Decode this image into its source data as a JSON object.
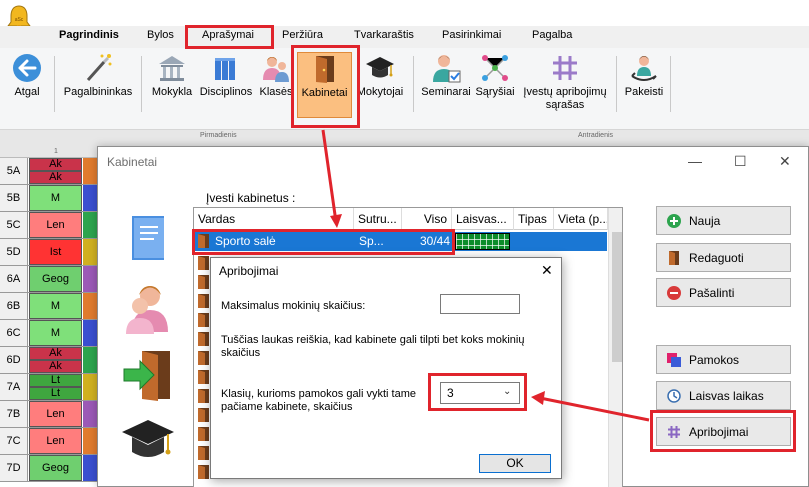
{
  "menu": {
    "items": [
      "Pagrindinis",
      "Bylos",
      "Aprašymai",
      "Peržiūra",
      "Tvarkaraštis",
      "Pasirinkimai",
      "Pagalba"
    ],
    "active": "Aprašymai"
  },
  "toolbar": {
    "atgal": "Atgal",
    "pagalbininkas": "Pagalbininkas",
    "mokykla": "Mokykla",
    "disciplinos": "Disciplinos",
    "klases": "Klasės",
    "kabinetai": "Kabinetai",
    "mokytojai": "Mokytojai",
    "seminarai": "Seminarai",
    "sarysiai": "Sąryšiai",
    "ivestu_1": "Įvestų apribojimų",
    "ivestu_2": "sąrašas",
    "pakeisti": "Pakeisti"
  },
  "timetable": {
    "day1": "Pirmadienis",
    "day2": "Antradienis",
    "period": "1",
    "rows": [
      {
        "cls": "5A",
        "cells": [
          "Ak",
          "Ak"
        ]
      },
      {
        "cls": "5B",
        "cells": [
          "M"
        ]
      },
      {
        "cls": "5C",
        "cells": [
          "Len"
        ]
      },
      {
        "cls": "5D",
        "cells": [
          "Ist"
        ]
      },
      {
        "cls": "6A",
        "cells": [
          "Geog"
        ]
      },
      {
        "cls": "6B",
        "cells": [
          "M"
        ]
      },
      {
        "cls": "6C",
        "cells": [
          "M"
        ]
      },
      {
        "cls": "6D",
        "cells": [
          "Ak",
          "Ak"
        ]
      },
      {
        "cls": "7A",
        "cells": [
          "Lt",
          "Lt"
        ]
      },
      {
        "cls": "7B",
        "cells": [
          "Len"
        ]
      },
      {
        "cls": "7C",
        "cells": [
          "Len"
        ]
      },
      {
        "cls": "7D",
        "cells": [
          "Geog"
        ]
      }
    ]
  },
  "kabinetai": {
    "title": "Kabinetai",
    "ivesti_label": "Įvesti kabinetus :",
    "columns": [
      "Vardas",
      "Sutru...",
      "Viso",
      "Laisvas...",
      "Tipas",
      "Vieta (p..."
    ],
    "selected_row": {
      "vardas": "Sporto salė",
      "sutr": "Sp...",
      "viso": "30/44"
    },
    "buttons": {
      "nauja": "Nauja",
      "redaguoti": "Redaguoti",
      "pasalinti": "Pašalinti",
      "pamokos": "Pamokos",
      "laisvas": "Laisvas laikas",
      "apribojimai": "Apribojimai"
    }
  },
  "dialog": {
    "title": "Apribojimai",
    "max_label": "Maksimalus mokinių skaičius:",
    "max_value": "",
    "hint_1": "Tuščias laukas reiškia, kad kabinete gali tilpti bet koks mokinių",
    "hint_2": "skaičius",
    "klas_label_1": "Klasių, kurioms pamokos gali vykti tame",
    "klas_label_2": "pačiame kabinete, skaičius",
    "klas_value": "3",
    "ok": "OK"
  },
  "colors": {
    "annotation_red": "#e0242c",
    "selection_blue": "#1a77d4",
    "active_tool": "#fbbf80"
  }
}
